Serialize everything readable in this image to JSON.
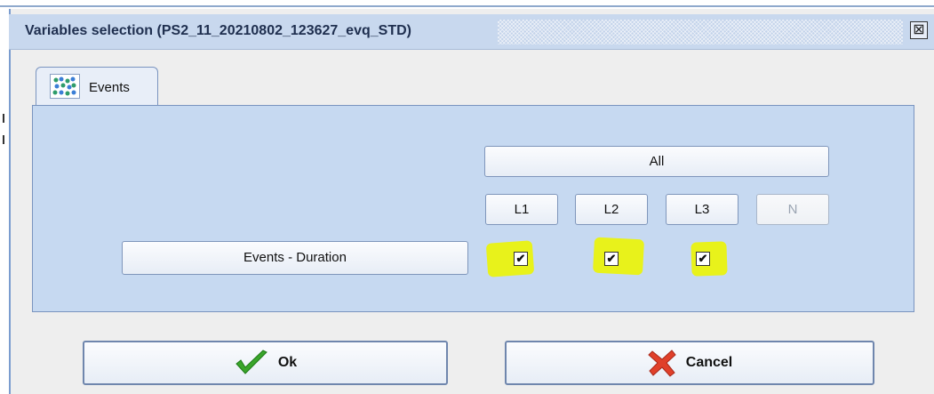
{
  "dialog": {
    "title": "Variables selection (PS2_11_20210802_123627_evq_STD)",
    "close_glyph": "⊠"
  },
  "tabs": [
    {
      "label": "Events",
      "icon": "scatter-grid-icon"
    }
  ],
  "levels": {
    "all_label": "All",
    "buttons": [
      "L1",
      "L2",
      "L3",
      "N"
    ]
  },
  "variables": [
    {
      "label": "Events - Duration",
      "checks": {
        "L1": true,
        "L2": true,
        "L3": true
      }
    }
  ],
  "checkmark_glyph": "✔",
  "actions": {
    "ok_label": "Ok",
    "cancel_label": "Cancel"
  },
  "colors": {
    "panel": "#c6d9f1",
    "highlight": "#e8f21b",
    "ok_icon": "#3aa52a",
    "cancel_icon": "#e0402a"
  }
}
